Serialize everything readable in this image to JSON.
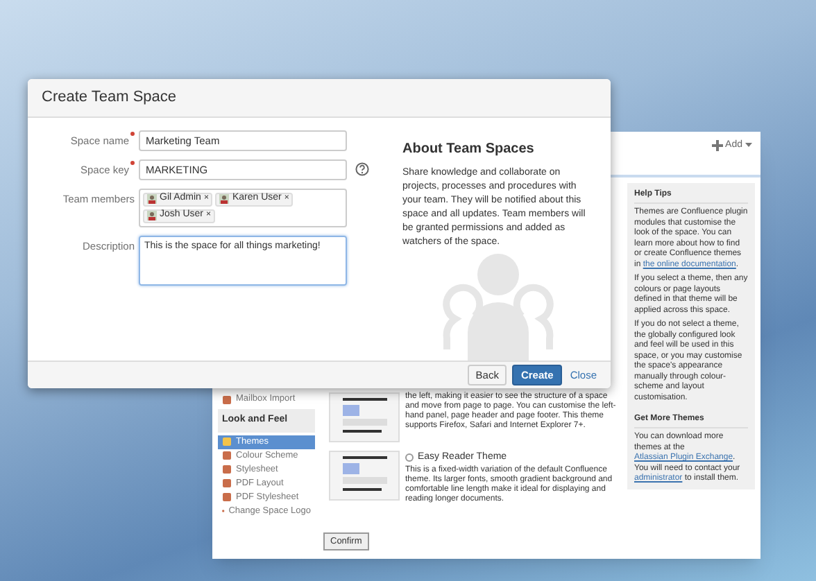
{
  "dialog": {
    "title": "Create Team Space",
    "fields": [
      {
        "kind": "text",
        "label": "Space name",
        "required": true,
        "value": "Marketing Team"
      },
      {
        "kind": "text-help",
        "label": "Space key",
        "required": true,
        "value": "MARKETING"
      },
      {
        "kind": "members",
        "label": "Team members",
        "required": false,
        "members": [
          {
            "name": "Gil Admin",
            "remove": "×"
          },
          {
            "name": "Karen User",
            "remove": "×"
          },
          {
            "name": "Josh User",
            "remove": "×"
          }
        ]
      },
      {
        "kind": "textarea",
        "label": "Description",
        "required": false,
        "value": "This is the space for all things marketing!"
      }
    ],
    "about": {
      "title": "About Team Spaces",
      "text": "Share knowledge and collaborate on projects, processes and procedures with your team. They will be notified about this space and all updates. Team members will be granted permissions and added as watchers of the space."
    },
    "buttons": [
      {
        "kind": "secondary",
        "label": "Back"
      },
      {
        "kind": "primary",
        "label": "Create"
      },
      {
        "kind": "link",
        "label": "Close"
      }
    ]
  },
  "background_window": {
    "add_button": "Add",
    "sidebar": [
      {
        "kind": "item",
        "label": "Mailbox Import",
        "selected": false
      },
      {
        "kind": "heading",
        "label": "Look and Feel"
      },
      {
        "kind": "item",
        "label": "Themes",
        "selected": true
      },
      {
        "kind": "item",
        "label": "Colour Scheme",
        "selected": false
      },
      {
        "kind": "item",
        "label": "Stylesheet",
        "selected": false
      },
      {
        "kind": "item",
        "label": "PDF Layout",
        "selected": false
      },
      {
        "kind": "item",
        "label": "PDF Stylesheet",
        "selected": false
      },
      {
        "kind": "item",
        "label": "Change Space Logo",
        "selected": false
      }
    ],
    "themes": [
      {
        "description": "the left, making it easier to see the structure of a space and move from page to page. You can customise the left-hand panel, page header and page footer. This theme supports Firefox, Safari and Internet Explorer 7+."
      },
      {
        "name": "Easy Reader Theme",
        "selected": false,
        "description": "This is a fixed-width variation of the default Confluence theme. Its larger fonts, smooth gradient background and comfortable line length make it ideal for displaying and reading longer documents."
      }
    ],
    "confirm_button": "Confirm",
    "help_panel": [
      {
        "title": "Help Tips",
        "paragraphs": [
          [
            {
              "text": "Themes are Confluence plugin modules that customise the look of the space. You can learn more about how to find or create Confluence themes in "
            },
            {
              "text": "the online documentation",
              "link": true
            },
            {
              "text": "."
            }
          ],
          [
            {
              "text": "If you select a theme, then any colours or page layouts defined in that theme will be applied across this space."
            }
          ],
          [
            {
              "text": "If you do not select a theme, the globally configured look and feel will be used in this space, or you may customise the space's appearance manually through colour-scheme and layout customisation."
            }
          ]
        ]
      },
      {
        "title": "Get More Themes",
        "paragraphs": [
          [
            {
              "text": "You can download more themes at the "
            },
            {
              "text": "Atlassian Plugin Exchange",
              "link": true
            },
            {
              "text": ". You will need to contact your "
            },
            {
              "text": "administrator",
              "link": true
            },
            {
              "text": " to install them."
            }
          ]
        ]
      }
    ]
  }
}
